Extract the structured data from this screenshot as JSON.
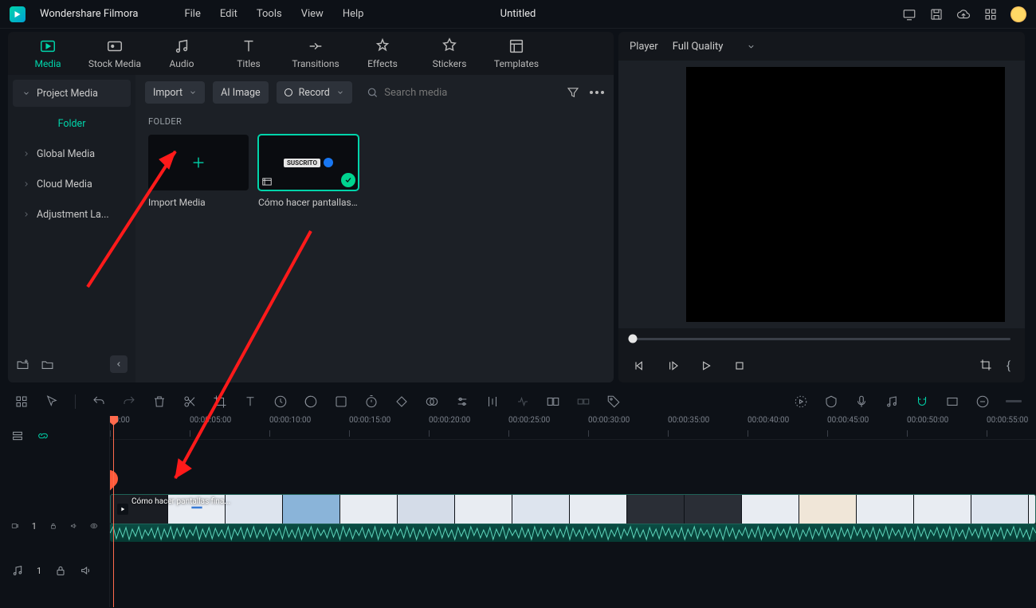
{
  "app": {
    "name": "Wondershare Filmora",
    "docTitle": "Untitled"
  },
  "menu": [
    "File",
    "Edit",
    "Tools",
    "View",
    "Help"
  ],
  "catTabs": [
    {
      "label": "Media",
      "active": true
    },
    {
      "label": "Stock Media"
    },
    {
      "label": "Audio"
    },
    {
      "label": "Titles"
    },
    {
      "label": "Transitions"
    },
    {
      "label": "Effects"
    },
    {
      "label": "Stickers"
    },
    {
      "label": "Templates"
    }
  ],
  "sidebar": {
    "projectMedia": "Project Media",
    "folder": "Folder",
    "items": [
      "Global Media",
      "Cloud Media",
      "Adjustment La..."
    ]
  },
  "toolbar": {
    "import": "Import",
    "aiImage": "AI Image",
    "record": "Record",
    "searchPlaceholder": "Search media"
  },
  "folderLabel": "FOLDER",
  "mediaItems": [
    {
      "type": "import",
      "caption": "Import Media"
    },
    {
      "type": "clip",
      "caption": "Cómo hacer pantallas ...",
      "badge": "SUSCRITO"
    }
  ],
  "player": {
    "label": "Player",
    "quality": "Full Quality"
  },
  "ruler": [
    "00:00",
    "00:00:05:00",
    "00:00:10:00",
    "00:00:15:00",
    "00:00:20:00",
    "00:00:25:00",
    "00:00:30:00",
    "00:00:35:00",
    "00:00:40:00",
    "00:00:45:00",
    "00:00:50:00",
    "00:00:55:00"
  ],
  "tracks": {
    "video": "1",
    "audio": "1"
  },
  "clip": {
    "title": "Cómo hacer pantallas fina..."
  }
}
